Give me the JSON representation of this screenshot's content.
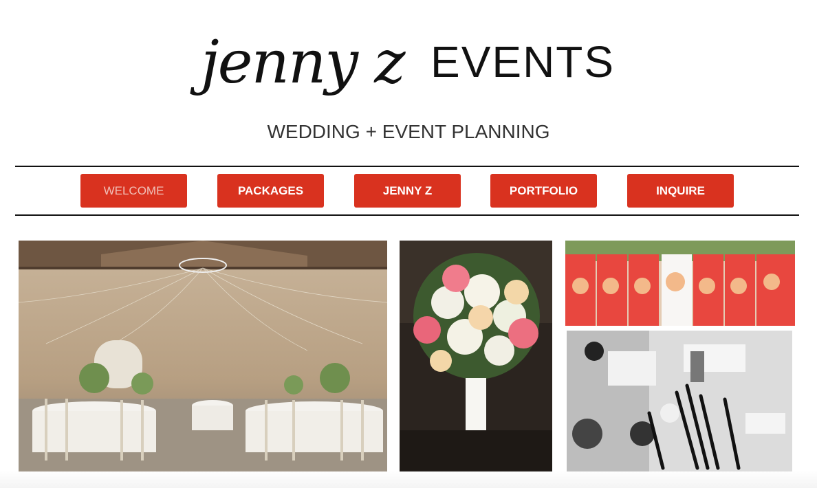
{
  "brand": {
    "script_name": "jenny z",
    "events_word": "EVENTS",
    "tagline": "WEDDING + EVENT PLANNING"
  },
  "nav": {
    "items": [
      {
        "label": "WELCOME",
        "active": true
      },
      {
        "label": "PACKAGES",
        "active": false
      },
      {
        "label": "JENNY Z",
        "active": false
      },
      {
        "label": "PORTFOLIO",
        "active": false
      },
      {
        "label": "INQUIRE",
        "active": false
      }
    ]
  },
  "colors": {
    "accent": "#d9321f",
    "text": "#111111"
  },
  "gallery": {
    "photos": [
      {
        "subject": "barn-reception-photo"
      },
      {
        "subject": "bridal-bouquet-photo"
      },
      {
        "subject": "bridesmaids-photo"
      },
      {
        "subject": "makeup-products-photo"
      }
    ]
  }
}
